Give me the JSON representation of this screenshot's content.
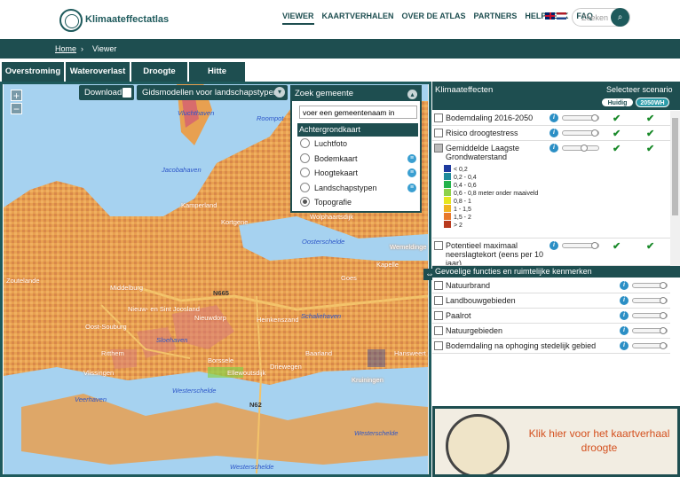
{
  "header": {
    "brand": "Klimaateffectatlas",
    "nav": [
      "VIEWER",
      "KAARTVERHALEN",
      "OVER DE ATLAS",
      "PARTNERS",
      "HELPDESK",
      "FAQ"
    ],
    "search_placeholder": "Zoeken",
    "search_icon": "magnifier-icon"
  },
  "breadcrumb": {
    "home": "Home",
    "separator": "›",
    "current": "Viewer"
  },
  "tabs": [
    "Overstroming",
    "Wateroverlast",
    "Droogte",
    "Hitte"
  ],
  "map": {
    "download": "Download",
    "models": "Gidsmodellen voor landschapstypen",
    "zoom_in": "+",
    "zoom_out": "−",
    "search_panel": {
      "title": "Zoek gemeente",
      "input_value": "voer een gemeentenaam in",
      "background_title": "Achtergrondkaart",
      "options": [
        "Luchtfoto",
        "Bodemkaart",
        "Hoogtekaart",
        "Landschapstypen",
        "Topografie"
      ],
      "selected": "Topografie"
    },
    "labels": {
      "water": [
        "Vluchthaven",
        "Roompot",
        "Jacobahaven",
        "Oosterschelde",
        "Sloehaven",
        "Schaliehaven",
        "Westerschelde",
        "Westerschelde",
        "Westerschelde",
        "Veerhaven"
      ],
      "towns": [
        "Kamperland",
        "Zoutelande",
        "Middelburg",
        "Nieuw- en Sint Joosland",
        "Heinkenszand",
        "Ellewoutsdijk",
        "Kapelle",
        "Vlissingen",
        "Ritthem",
        "Borssele",
        "Nieuwdorp",
        "Oost-Souburg",
        "Baarland",
        "Kruiningen",
        "Driewegen",
        "Wolphaartsdijk",
        "Kortgene",
        "Wemeldinge",
        "Goes",
        "Hansweert"
      ],
      "roads": [
        "N665",
        "N62"
      ]
    }
  },
  "right": {
    "title": "Klimaateffecten",
    "scenario_label": "Selecteer scenario",
    "scenarios": [
      "Huidig",
      "2050WH"
    ],
    "effects": [
      {
        "name": "Bodemdaling 2016-2050",
        "current": true,
        "future": true
      },
      {
        "name": "Risico droogtestress",
        "current": true,
        "future": true
      },
      {
        "name": "Gemiddelde Laagste Grondwaterstand",
        "current": true,
        "future": true
      },
      {
        "name": "Potentieel maximaal neerslagtekort (eens per 10 jaar)",
        "current": true,
        "future": true
      }
    ],
    "legend": [
      {
        "label": "< 0,2",
        "color": "#1d3a9e"
      },
      {
        "label": "0,2 - 0,4",
        "color": "#1e8a9a"
      },
      {
        "label": "0,4 - 0,6",
        "color": "#22b24a"
      },
      {
        "label": "0,6 - 0,8 meter onder maaiveld",
        "color": "#8dd24a"
      },
      {
        "label": "0,8 - 1",
        "color": "#e6e61e"
      },
      {
        "label": "1 - 1,5",
        "color": "#f0b41e"
      },
      {
        "label": "1,5 - 2",
        "color": "#e8782a"
      },
      {
        "label": "> 2",
        "color": "#b83a1e"
      }
    ],
    "sensitive_title": "Gevoelige functies en ruimtelijke kenmerken",
    "sensitive": [
      "Natuurbrand",
      "Landbouwgebieden",
      "Paalrot",
      "Natuurgebieden",
      "Bodemdaling na ophoging stedelijk gebied"
    ],
    "promo": "Klik hier voor het kaartverhaal droogte"
  },
  "colors": {
    "brand": "#1e4e50",
    "map_base": "#e8a050",
    "check": "#1a8a2a"
  }
}
